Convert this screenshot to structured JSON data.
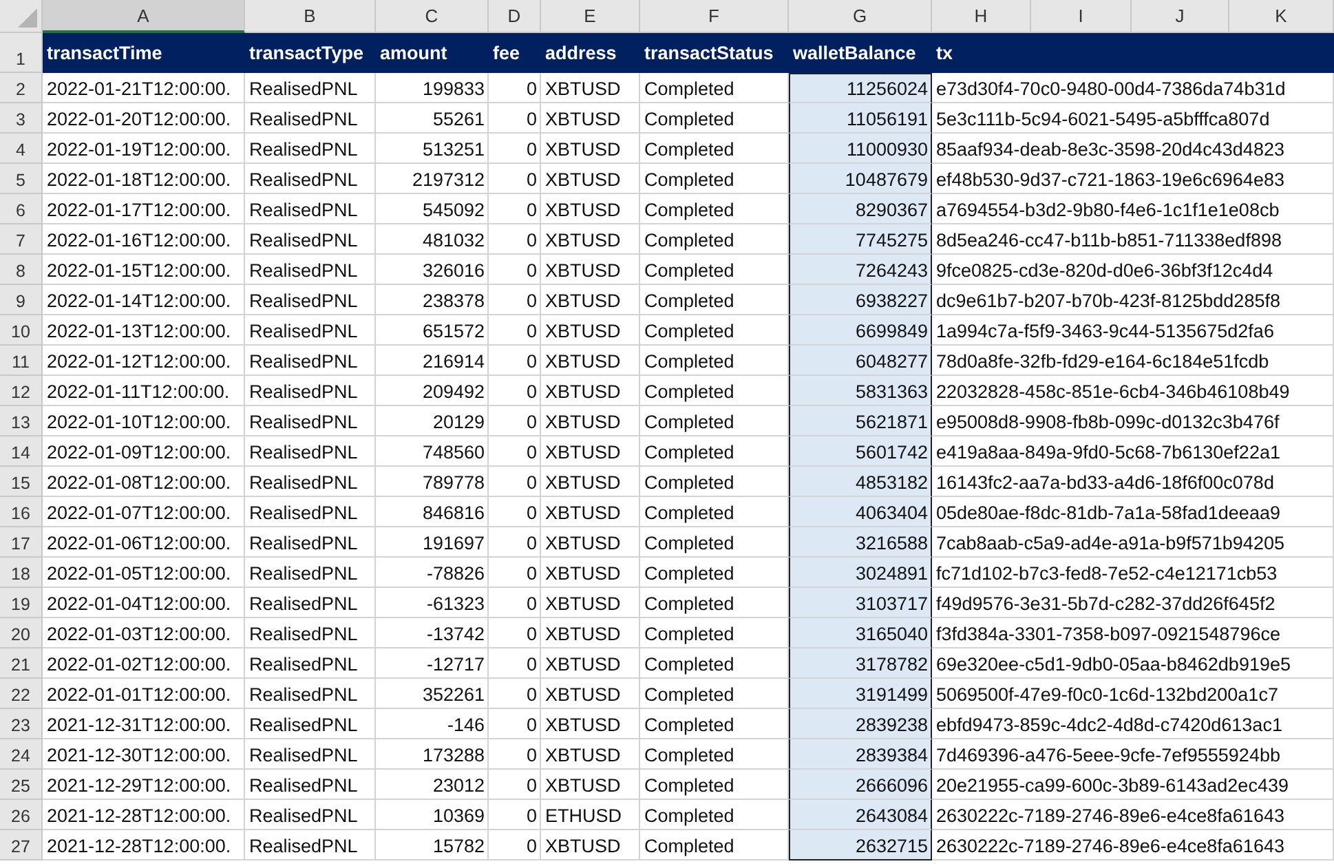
{
  "column_headers": [
    {
      "letter": "A",
      "selected": true
    },
    {
      "letter": "B",
      "selected": false
    },
    {
      "letter": "C",
      "selected": false
    },
    {
      "letter": "D",
      "selected": false
    },
    {
      "letter": "E",
      "selected": false
    },
    {
      "letter": "F",
      "selected": false
    },
    {
      "letter": "G",
      "selected": false
    },
    {
      "letter": "H",
      "selected": false
    },
    {
      "letter": "I",
      "selected": false
    },
    {
      "letter": "J",
      "selected": false
    },
    {
      "letter": "K",
      "selected": false
    }
  ],
  "header_row": {
    "number": "1",
    "cells": [
      {
        "label": "transactTime",
        "kind": "text"
      },
      {
        "label": "transactType",
        "kind": "text"
      },
      {
        "label": "amount",
        "kind": "number"
      },
      {
        "label": "fee",
        "kind": "number"
      },
      {
        "label": "address",
        "kind": "text"
      },
      {
        "label": "transactStatus",
        "kind": "text"
      },
      {
        "label": "walletBalance",
        "kind": "number"
      },
      {
        "label": "tx",
        "kind": "text"
      }
    ]
  },
  "rows": [
    {
      "number": "2",
      "cells": [
        {
          "text": "2022-01-21T12:00:00.",
          "selected": false
        },
        {
          "text": "RealisedPNL",
          "selected": false
        },
        {
          "text": "199833",
          "selected": false
        },
        {
          "text": "0",
          "selected": false
        },
        {
          "text": "XBTUSD",
          "selected": false
        },
        {
          "text": "Completed",
          "selected": false
        },
        {
          "text": "11256024",
          "selected": true
        },
        {
          "text": "e73d30f4-70c0-9480-00d4-7386da74b31d",
          "selected": false
        }
      ]
    },
    {
      "number": "3",
      "cells": [
        {
          "text": "2022-01-20T12:00:00.",
          "selected": false
        },
        {
          "text": "RealisedPNL",
          "selected": false
        },
        {
          "text": "55261",
          "selected": false
        },
        {
          "text": "0",
          "selected": false
        },
        {
          "text": "XBTUSD",
          "selected": false
        },
        {
          "text": "Completed",
          "selected": false
        },
        {
          "text": "11056191",
          "selected": true
        },
        {
          "text": "5e3c111b-5c94-6021-5495-a5bfffca807d",
          "selected": false
        }
      ]
    },
    {
      "number": "4",
      "cells": [
        {
          "text": "2022-01-19T12:00:00.",
          "selected": false
        },
        {
          "text": "RealisedPNL",
          "selected": false
        },
        {
          "text": "513251",
          "selected": false
        },
        {
          "text": "0",
          "selected": false
        },
        {
          "text": "XBTUSD",
          "selected": false
        },
        {
          "text": "Completed",
          "selected": false
        },
        {
          "text": "11000930",
          "selected": true
        },
        {
          "text": "85aaf934-deab-8e3c-3598-20d4c43d4823",
          "selected": false
        }
      ]
    },
    {
      "number": "5",
      "cells": [
        {
          "text": "2022-01-18T12:00:00.",
          "selected": false
        },
        {
          "text": "RealisedPNL",
          "selected": false
        },
        {
          "text": "2197312",
          "selected": false
        },
        {
          "text": "0",
          "selected": false
        },
        {
          "text": "XBTUSD",
          "selected": false
        },
        {
          "text": "Completed",
          "selected": false
        },
        {
          "text": "10487679",
          "selected": true
        },
        {
          "text": "ef48b530-9d37-c721-1863-19e6c6964e83",
          "selected": false
        }
      ]
    },
    {
      "number": "6",
      "cells": [
        {
          "text": "2022-01-17T12:00:00.",
          "selected": false
        },
        {
          "text": "RealisedPNL",
          "selected": false
        },
        {
          "text": "545092",
          "selected": false
        },
        {
          "text": "0",
          "selected": false
        },
        {
          "text": "XBTUSD",
          "selected": false
        },
        {
          "text": "Completed",
          "selected": false
        },
        {
          "text": "8290367",
          "selected": true
        },
        {
          "text": "a7694554-b3d2-9b80-f4e6-1c1f1e1e08cb",
          "selected": false
        }
      ]
    },
    {
      "number": "7",
      "cells": [
        {
          "text": "2022-01-16T12:00:00.",
          "selected": false
        },
        {
          "text": "RealisedPNL",
          "selected": false
        },
        {
          "text": "481032",
          "selected": false
        },
        {
          "text": "0",
          "selected": false
        },
        {
          "text": "XBTUSD",
          "selected": false
        },
        {
          "text": "Completed",
          "selected": false
        },
        {
          "text": "7745275",
          "selected": true
        },
        {
          "text": "8d5ea246-cc47-b11b-b851-711338edf898",
          "selected": false
        }
      ]
    },
    {
      "number": "8",
      "cells": [
        {
          "text": "2022-01-15T12:00:00.",
          "selected": false
        },
        {
          "text": "RealisedPNL",
          "selected": false
        },
        {
          "text": "326016",
          "selected": false
        },
        {
          "text": "0",
          "selected": false
        },
        {
          "text": "XBTUSD",
          "selected": false
        },
        {
          "text": "Completed",
          "selected": false
        },
        {
          "text": "7264243",
          "selected": true
        },
        {
          "text": "9fce0825-cd3e-820d-d0e6-36bf3f12c4d4",
          "selected": false
        }
      ]
    },
    {
      "number": "9",
      "cells": [
        {
          "text": "2022-01-14T12:00:00.",
          "selected": false
        },
        {
          "text": "RealisedPNL",
          "selected": false
        },
        {
          "text": "238378",
          "selected": false
        },
        {
          "text": "0",
          "selected": false
        },
        {
          "text": "XBTUSD",
          "selected": false
        },
        {
          "text": "Completed",
          "selected": false
        },
        {
          "text": "6938227",
          "selected": true
        },
        {
          "text": "dc9e61b7-b207-b70b-423f-8125bdd285f8",
          "selected": false
        }
      ]
    },
    {
      "number": "10",
      "cells": [
        {
          "text": "2022-01-13T12:00:00.",
          "selected": false
        },
        {
          "text": "RealisedPNL",
          "selected": false
        },
        {
          "text": "651572",
          "selected": false
        },
        {
          "text": "0",
          "selected": false
        },
        {
          "text": "XBTUSD",
          "selected": false
        },
        {
          "text": "Completed",
          "selected": false
        },
        {
          "text": "6699849",
          "selected": true
        },
        {
          "text": "1a994c7a-f5f9-3463-9c44-5135675d2fa6",
          "selected": false
        }
      ]
    },
    {
      "number": "11",
      "cells": [
        {
          "text": "2022-01-12T12:00:00.",
          "selected": false
        },
        {
          "text": "RealisedPNL",
          "selected": false
        },
        {
          "text": "216914",
          "selected": false
        },
        {
          "text": "0",
          "selected": false
        },
        {
          "text": "XBTUSD",
          "selected": false
        },
        {
          "text": "Completed",
          "selected": false
        },
        {
          "text": "6048277",
          "selected": true
        },
        {
          "text": "78d0a8fe-32fb-fd29-e164-6c184e51fcdb",
          "selected": false
        }
      ]
    },
    {
      "number": "12",
      "cells": [
        {
          "text": "2022-01-11T12:00:00.",
          "selected": false
        },
        {
          "text": "RealisedPNL",
          "selected": false
        },
        {
          "text": "209492",
          "selected": false
        },
        {
          "text": "0",
          "selected": false
        },
        {
          "text": "XBTUSD",
          "selected": false
        },
        {
          "text": "Completed",
          "selected": false
        },
        {
          "text": "5831363",
          "selected": true
        },
        {
          "text": "22032828-458c-851e-6cb4-346b46108b49",
          "selected": false
        }
      ]
    },
    {
      "number": "13",
      "cells": [
        {
          "text": "2022-01-10T12:00:00.",
          "selected": false
        },
        {
          "text": "RealisedPNL",
          "selected": false
        },
        {
          "text": "20129",
          "selected": false
        },
        {
          "text": "0",
          "selected": false
        },
        {
          "text": "XBTUSD",
          "selected": false
        },
        {
          "text": "Completed",
          "selected": false
        },
        {
          "text": "5621871",
          "selected": true
        },
        {
          "text": "e95008d8-9908-fb8b-099c-d0132c3b476f",
          "selected": false
        }
      ]
    },
    {
      "number": "14",
      "cells": [
        {
          "text": "2022-01-09T12:00:00.",
          "selected": false
        },
        {
          "text": "RealisedPNL",
          "selected": false
        },
        {
          "text": "748560",
          "selected": false
        },
        {
          "text": "0",
          "selected": false
        },
        {
          "text": "XBTUSD",
          "selected": false
        },
        {
          "text": "Completed",
          "selected": false
        },
        {
          "text": "5601742",
          "selected": true
        },
        {
          "text": "e419a8aa-849a-9fd0-5c68-7b6130ef22a1",
          "selected": false
        }
      ]
    },
    {
      "number": "15",
      "cells": [
        {
          "text": "2022-01-08T12:00:00.",
          "selected": false
        },
        {
          "text": "RealisedPNL",
          "selected": false
        },
        {
          "text": "789778",
          "selected": false
        },
        {
          "text": "0",
          "selected": false
        },
        {
          "text": "XBTUSD",
          "selected": false
        },
        {
          "text": "Completed",
          "selected": false
        },
        {
          "text": "4853182",
          "selected": true
        },
        {
          "text": "16143fc2-aa7a-bd33-a4d6-18f6f00c078d",
          "selected": false
        }
      ]
    },
    {
      "number": "16",
      "cells": [
        {
          "text": "2022-01-07T12:00:00.",
          "selected": false
        },
        {
          "text": "RealisedPNL",
          "selected": false
        },
        {
          "text": "846816",
          "selected": false
        },
        {
          "text": "0",
          "selected": false
        },
        {
          "text": "XBTUSD",
          "selected": false
        },
        {
          "text": "Completed",
          "selected": false
        },
        {
          "text": "4063404",
          "selected": true
        },
        {
          "text": "05de80ae-f8dc-81db-7a1a-58fad1deeaa9",
          "selected": false
        }
      ]
    },
    {
      "number": "17",
      "cells": [
        {
          "text": "2022-01-06T12:00:00.",
          "selected": false
        },
        {
          "text": "RealisedPNL",
          "selected": false
        },
        {
          "text": "191697",
          "selected": false
        },
        {
          "text": "0",
          "selected": false
        },
        {
          "text": "XBTUSD",
          "selected": false
        },
        {
          "text": "Completed",
          "selected": false
        },
        {
          "text": "3216588",
          "selected": true
        },
        {
          "text": "7cab8aab-c5a9-ad4e-a91a-b9f571b94205",
          "selected": false
        }
      ]
    },
    {
      "number": "18",
      "cells": [
        {
          "text": "2022-01-05T12:00:00.",
          "selected": false
        },
        {
          "text": "RealisedPNL",
          "selected": false
        },
        {
          "text": "-78826",
          "selected": false
        },
        {
          "text": "0",
          "selected": false
        },
        {
          "text": "XBTUSD",
          "selected": false
        },
        {
          "text": "Completed",
          "selected": false
        },
        {
          "text": "3024891",
          "selected": true
        },
        {
          "text": "fc71d102-b7c3-fed8-7e52-c4e12171cb53",
          "selected": false
        }
      ]
    },
    {
      "number": "19",
      "cells": [
        {
          "text": "2022-01-04T12:00:00.",
          "selected": false
        },
        {
          "text": "RealisedPNL",
          "selected": false
        },
        {
          "text": "-61323",
          "selected": false
        },
        {
          "text": "0",
          "selected": false
        },
        {
          "text": "XBTUSD",
          "selected": false
        },
        {
          "text": "Completed",
          "selected": false
        },
        {
          "text": "3103717",
          "selected": true
        },
        {
          "text": "f49d9576-3e31-5b7d-c282-37dd26f645f2",
          "selected": false
        }
      ]
    },
    {
      "number": "20",
      "cells": [
        {
          "text": "2022-01-03T12:00:00.",
          "selected": false
        },
        {
          "text": "RealisedPNL",
          "selected": false
        },
        {
          "text": "-13742",
          "selected": false
        },
        {
          "text": "0",
          "selected": false
        },
        {
          "text": "XBTUSD",
          "selected": false
        },
        {
          "text": "Completed",
          "selected": false
        },
        {
          "text": "3165040",
          "selected": true
        },
        {
          "text": "f3fd384a-3301-7358-b097-0921548796ce",
          "selected": false
        }
      ]
    },
    {
      "number": "21",
      "cells": [
        {
          "text": "2022-01-02T12:00:00.",
          "selected": false
        },
        {
          "text": "RealisedPNL",
          "selected": false
        },
        {
          "text": "-12717",
          "selected": false
        },
        {
          "text": "0",
          "selected": false
        },
        {
          "text": "XBTUSD",
          "selected": false
        },
        {
          "text": "Completed",
          "selected": false
        },
        {
          "text": "3178782",
          "selected": true
        },
        {
          "text": "69e320ee-c5d1-9db0-05aa-b8462db919e5",
          "selected": false
        }
      ]
    },
    {
      "number": "22",
      "cells": [
        {
          "text": "2022-01-01T12:00:00.",
          "selected": false
        },
        {
          "text": "RealisedPNL",
          "selected": false
        },
        {
          "text": "352261",
          "selected": false
        },
        {
          "text": "0",
          "selected": false
        },
        {
          "text": "XBTUSD",
          "selected": false
        },
        {
          "text": "Completed",
          "selected": false
        },
        {
          "text": "3191499",
          "selected": true
        },
        {
          "text": "5069500f-47e9-f0c0-1c6d-132bd200a1c7",
          "selected": false
        }
      ]
    },
    {
      "number": "23",
      "cells": [
        {
          "text": "2021-12-31T12:00:00.",
          "selected": false
        },
        {
          "text": "RealisedPNL",
          "selected": false
        },
        {
          "text": "-146",
          "selected": false
        },
        {
          "text": "0",
          "selected": false
        },
        {
          "text": "XBTUSD",
          "selected": false
        },
        {
          "text": "Completed",
          "selected": false
        },
        {
          "text": "2839238",
          "selected": true
        },
        {
          "text": "ebfd9473-859c-4dc2-4d8d-c7420d613ac1",
          "selected": false
        }
      ]
    },
    {
      "number": "24",
      "cells": [
        {
          "text": "2021-12-30T12:00:00.",
          "selected": false
        },
        {
          "text": "RealisedPNL",
          "selected": false
        },
        {
          "text": "173288",
          "selected": false
        },
        {
          "text": "0",
          "selected": false
        },
        {
          "text": "XBTUSD",
          "selected": false
        },
        {
          "text": "Completed",
          "selected": false
        },
        {
          "text": "2839384",
          "selected": true
        },
        {
          "text": "7d469396-a476-5eee-9cfe-7ef9555924bb",
          "selected": false
        }
      ]
    },
    {
      "number": "25",
      "cells": [
        {
          "text": "2021-12-29T12:00:00.",
          "selected": false
        },
        {
          "text": "RealisedPNL",
          "selected": false
        },
        {
          "text": "23012",
          "selected": false
        },
        {
          "text": "0",
          "selected": false
        },
        {
          "text": "XBTUSD",
          "selected": false
        },
        {
          "text": "Completed",
          "selected": false
        },
        {
          "text": "2666096",
          "selected": true
        },
        {
          "text": "20e21955-ca99-600c-3b89-6143ad2ec439",
          "selected": false
        }
      ]
    },
    {
      "number": "26",
      "cells": [
        {
          "text": "2021-12-28T12:00:00.",
          "selected": false
        },
        {
          "text": "RealisedPNL",
          "selected": false
        },
        {
          "text": "10369",
          "selected": false
        },
        {
          "text": "0",
          "selected": false
        },
        {
          "text": "ETHUSD",
          "selected": false
        },
        {
          "text": "Completed",
          "selected": false
        },
        {
          "text": "2643084",
          "selected": true
        },
        {
          "text": "2630222c-7189-2746-89e6-e4ce8fa61643",
          "selected": false
        }
      ]
    },
    {
      "number": "27",
      "cells": [
        {
          "text": "2021-12-28T12:00:00.",
          "selected": false
        },
        {
          "text": "RealisedPNL",
          "selected": false
        },
        {
          "text": "15782",
          "selected": false
        },
        {
          "text": "0",
          "selected": false
        },
        {
          "text": "XBTUSD",
          "selected": false
        },
        {
          "text": "Completed",
          "selected": false
        },
        {
          "text": "2632715",
          "selected": true
        },
        {
          "text": "2630222c-7189-2746-89e6-e4ce8fa61643",
          "selected": false
        }
      ]
    }
  ]
}
